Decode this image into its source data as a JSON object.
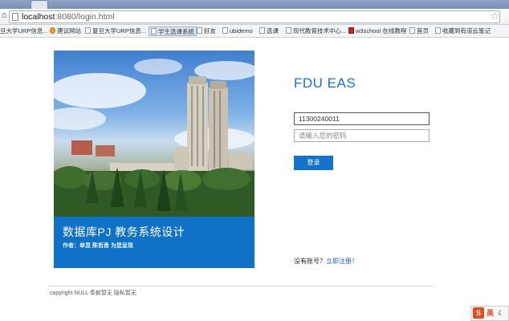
{
  "browser": {
    "url_host": "localhost",
    "url_path": ":8080/login.html",
    "bookmarks": [
      {
        "label": "旦大学URP信息..."
      },
      {
        "label": "建议网站"
      },
      {
        "label": "复旦大学URP信息..."
      },
      {
        "label": "学生选课系统"
      },
      {
        "label": "好友"
      },
      {
        "label": "ubidemo"
      },
      {
        "label": "选课"
      },
      {
        "label": "现代教育技术中心..."
      },
      {
        "label": "w3school 在线教程"
      },
      {
        "label": "首页"
      },
      {
        "label": "收藏到有道云笔记"
      }
    ],
    "icons": {
      "home": "home-icon",
      "page": "page-icon",
      "star": "star-icon"
    }
  },
  "hero": {
    "title": "数据库PJ 教务系统设计",
    "authors": "作者：单昱 陈哲勇 为您呈现",
    "caption_color": "#0f72c6"
  },
  "login": {
    "brand": "FDU EAS",
    "username_value": "11300240011",
    "password_placeholder": "请输入您的密码",
    "login_label": "登录",
    "accent_color": "#1673c9"
  },
  "register": {
    "prompt": "没有账号？",
    "link": "立即注册！"
  },
  "footer": {
    "text": "copyright NULL 条款暂无 隐私暂无"
  },
  "ime": {
    "logo": "S",
    "lang": "英"
  }
}
